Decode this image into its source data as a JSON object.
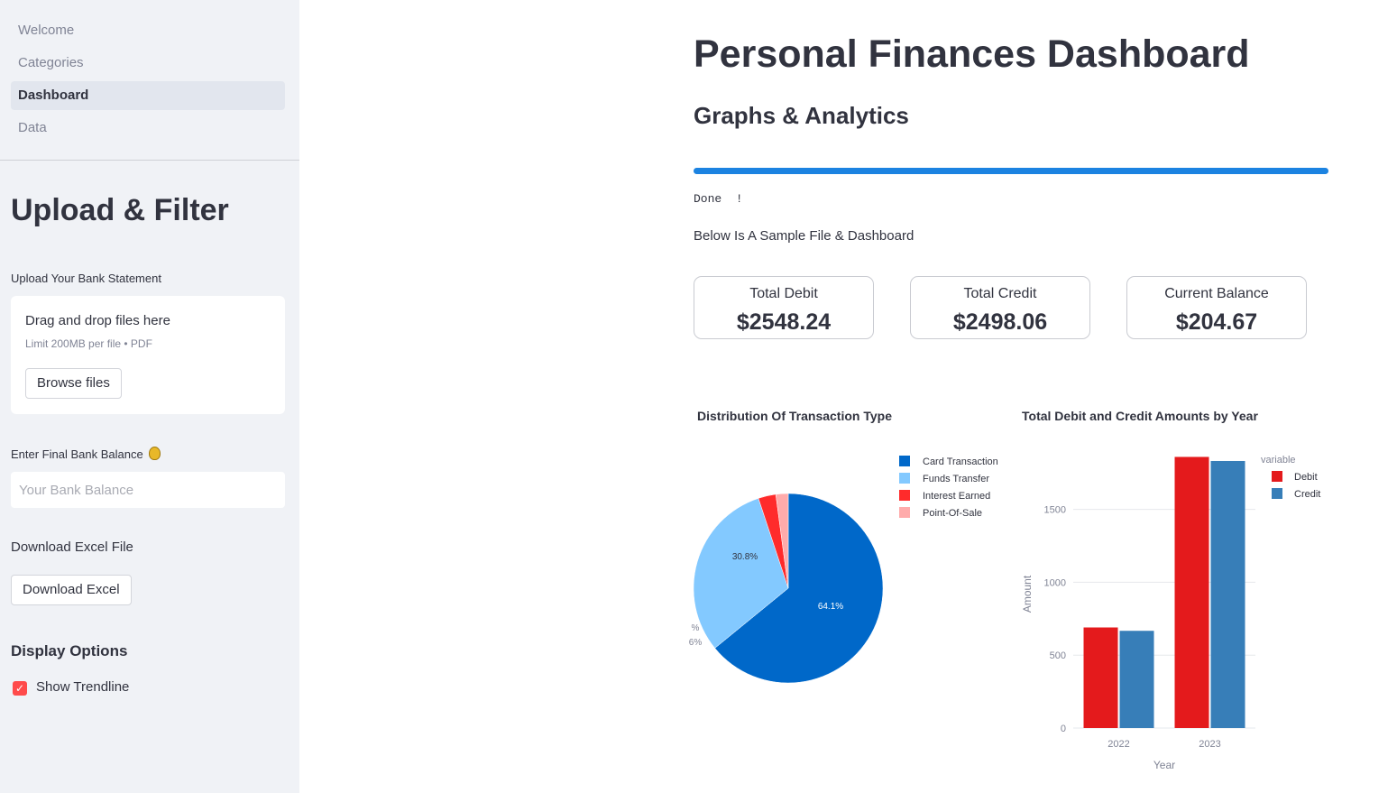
{
  "nav": {
    "items": [
      {
        "label": "Welcome",
        "active": false
      },
      {
        "label": "Categories",
        "active": false
      },
      {
        "label": "Dashboard",
        "active": true
      },
      {
        "label": "Data",
        "active": false
      }
    ]
  },
  "sidebar": {
    "title": "Upload & Filter",
    "upload": {
      "label": "Upload Your Bank Statement",
      "drop_text": "Drag and drop files here",
      "limit_text": "Limit 200MB per file • PDF",
      "browse_label": "Browse files"
    },
    "balance": {
      "label": "Enter Final Bank Balance",
      "icon": "money-bag-icon",
      "placeholder": "Your Bank Balance"
    },
    "download": {
      "label": "Download Excel File",
      "button_label": "Download Excel"
    },
    "display": {
      "heading": "Display Options",
      "checkbox_label": "Show Trendline",
      "checked": true
    }
  },
  "main": {
    "title": "Personal Finances Dashboard",
    "subtitle": "Graphs & Analytics",
    "progress": 100,
    "done_text": "Done  !",
    "sample_text": "Below Is A Sample File & Dashboard",
    "metrics": [
      {
        "label": "Total Debit",
        "value": "$2548.24"
      },
      {
        "label": "Total Credit",
        "value": "$2498.06"
      },
      {
        "label": "Current Balance",
        "value": "$204.67"
      }
    ]
  },
  "colors": {
    "accent": "#ff4b4b",
    "progress": "#1c83e1",
    "pie": [
      "#0068c9",
      "#83c9ff",
      "#ff2b2b",
      "#ffabab"
    ],
    "debit": "#e41a1c",
    "credit": "#377eb8"
  },
  "chart_data": [
    {
      "type": "pie",
      "title": "Distribution Of Transaction Type",
      "categories": [
        "Card Transaction",
        "Funds Transfer",
        "Interest Earned",
        "Point-Of-Sale"
      ],
      "values": [
        64.1,
        30.8,
        3.0,
        2.1
      ],
      "labels": [
        "64.1%",
        "30.8%",
        "%",
        "6%"
      ],
      "legend": "right"
    },
    {
      "type": "bar",
      "title": "Total Debit and Credit Amounts by Year",
      "categories": [
        "2022",
        "2023"
      ],
      "series": [
        {
          "name": "Debit",
          "values": [
            690,
            1860
          ]
        },
        {
          "name": "Credit",
          "values": [
            667,
            1832
          ]
        }
      ],
      "xlabel": "Year",
      "ylabel": "Amount",
      "yticks": [
        "0",
        "500",
        "1000",
        "1500"
      ],
      "ylim": [
        0,
        1900
      ],
      "legend_title": "variable",
      "legend": "top-right",
      "grid": true
    }
  ]
}
